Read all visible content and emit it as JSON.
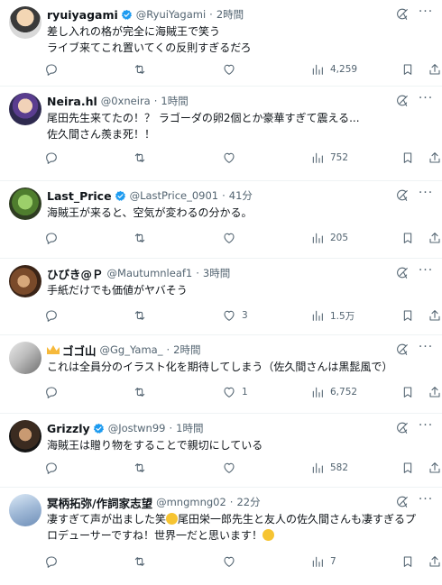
{
  "tweets": [
    {
      "name": "ryuiyagami",
      "verified": true,
      "handle": "@RyuiYagami",
      "sep": "·",
      "time": "2時間",
      "lines": [
        "差し入れの格が完全に海賊王で笑う",
        "ライブ来てこれ置いてくの反則すぎるだろ"
      ],
      "replies": "",
      "retweets": "",
      "likes": "",
      "views": "4,259"
    },
    {
      "name": "Neira.hl",
      "verified": false,
      "handle": "@0xneira",
      "sep": "·",
      "time": "1時間",
      "lines": [
        "尾田先生来てたの！？ ラゴーダの卵2個とか豪華すぎて震える...",
        "佐久間さん羨ま死！！"
      ],
      "replies": "",
      "retweets": "",
      "likes": "",
      "views": "752"
    },
    {
      "name": "Last_Price",
      "verified": true,
      "handle": "@LastPrice_0901",
      "sep": "·",
      "time": "41分",
      "lines": [
        "海賊王が来ると、空気が変わるの分かる。"
      ],
      "replies": "",
      "retweets": "",
      "likes": "",
      "views": "205"
    },
    {
      "name": "ひびき@Ｐ",
      "verified": false,
      "handle": "@Mautumnleaf1",
      "sep": "·",
      "time": "3時間",
      "lines": [
        "手紙だけでも価値がヤバそう"
      ],
      "replies": "",
      "retweets": "",
      "likes": "3",
      "views": "1.5万"
    },
    {
      "name": "ゴゴ山",
      "verified": false,
      "crown": true,
      "handle": "@Gg_Yama_",
      "sep": "·",
      "time": "2時間",
      "lines": [
        "これは全員分のイラスト化を期待してしまう（佐久間さんは黒髭風で）"
      ],
      "replies": "",
      "retweets": "",
      "likes": "1",
      "views": "6,752"
    },
    {
      "name": "Grizzly",
      "verified": true,
      "handle": "@Jostwn99",
      "sep": "·",
      "time": "1時間",
      "lines": [
        "海賊王は贈り物をすることで親切にしている"
      ],
      "replies": "",
      "retweets": "",
      "likes": "",
      "views": "582"
    },
    {
      "name": "冥柄拓弥/作詞家志望",
      "verified": false,
      "handle": "@mngmng02",
      "sep": "·",
      "time": "22分",
      "lines_rich": true,
      "line1_a": "凄すぎて声が出ました笑",
      "line1_b": "尾田栄一郎先生と友人の佐久間さんも凄すぎるプ",
      "line2_a": "ロデューサーですね！世界一だと思います！",
      "replies": "",
      "retweets": "",
      "likes": "",
      "views": "7"
    }
  ],
  "colors": {
    "verified": "#1d9bf0",
    "text": "#0f1419",
    "muted": "#536471",
    "divider": "#eff3f4"
  },
  "icons": {
    "reply": "reply-icon",
    "retweet": "retweet-icon",
    "like": "heart-icon",
    "views": "views-icon",
    "bookmark": "bookmark-icon",
    "share": "share-icon",
    "grok": "grok-icon",
    "more": "more-icon"
  }
}
